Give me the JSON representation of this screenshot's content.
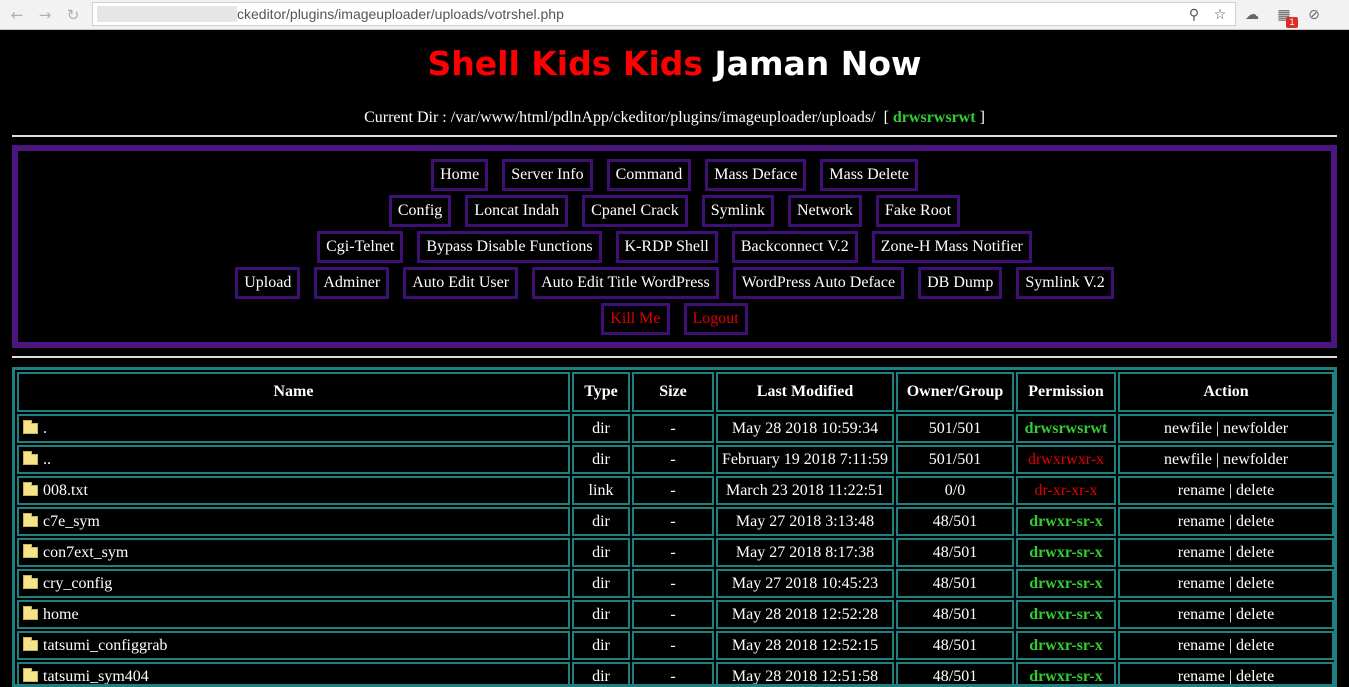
{
  "browser": {
    "url": "ckeditor/plugins/imageuploader/uploads/votrshel.php",
    "badge_count": "1"
  },
  "page": {
    "title_red": "Shell Kids Kids",
    "title_white": "Jaman Now",
    "current_dir_label": "Current Dir :",
    "current_dir": "/var/www/html/pdlnApp/ckeditor/plugins/imageuploader/uploads/",
    "current_perm": "drwsrwsrwt"
  },
  "menu": {
    "row1": [
      "Home",
      "Server Info",
      "Command",
      "Mass Deface",
      "Mass Delete"
    ],
    "row2": [
      "Config",
      "Loncat Indah",
      "Cpanel Crack",
      "Symlink",
      "Network",
      "Fake Root"
    ],
    "row3": [
      "Cgi-Telnet",
      "Bypass Disable Functions",
      "K-RDP Shell",
      "Backconnect V.2",
      "Zone-H Mass Notifier"
    ],
    "row4": [
      "Upload",
      "Adminer",
      "Auto Edit User",
      "Auto Edit Title WordPress",
      "WordPress Auto Deface",
      "DB Dump",
      "Symlink V.2"
    ],
    "row5": [
      "Kill Me",
      "Logout"
    ]
  },
  "table": {
    "headers": [
      "Name",
      "Type",
      "Size",
      "Last Modified",
      "Owner/Group",
      "Permission",
      "Action"
    ],
    "rows": [
      {
        "name": ".",
        "type": "dir",
        "size": "-",
        "modified": "May 28 2018 10:59:34",
        "owner": "501/501",
        "perm": "drwsrwsrwt",
        "perm_color": "green",
        "action1": "newfile",
        "action2": "newfolder"
      },
      {
        "name": "..",
        "type": "dir",
        "size": "-",
        "modified": "February 19 2018 7:11:59",
        "owner": "501/501",
        "perm": "drwxrwxr-x",
        "perm_color": "red",
        "action1": "newfile",
        "action2": "newfolder"
      },
      {
        "name": "008.txt",
        "type": "link",
        "size": "-",
        "modified": "March 23 2018 11:22:51",
        "owner": "0/0",
        "perm": "dr-xr-xr-x",
        "perm_color": "red",
        "action1": "rename",
        "action2": "delete"
      },
      {
        "name": "c7e_sym",
        "type": "dir",
        "size": "-",
        "modified": "May 27 2018 3:13:48",
        "owner": "48/501",
        "perm": "drwxr-sr-x",
        "perm_color": "green",
        "action1": "rename",
        "action2": "delete"
      },
      {
        "name": "con7ext_sym",
        "type": "dir",
        "size": "-",
        "modified": "May 27 2018 8:17:38",
        "owner": "48/501",
        "perm": "drwxr-sr-x",
        "perm_color": "green",
        "action1": "rename",
        "action2": "delete"
      },
      {
        "name": "cry_config",
        "type": "dir",
        "size": "-",
        "modified": "May 27 2018 10:45:23",
        "owner": "48/501",
        "perm": "drwxr-sr-x",
        "perm_color": "green",
        "action1": "rename",
        "action2": "delete"
      },
      {
        "name": "home",
        "type": "dir",
        "size": "-",
        "modified": "May 28 2018 12:52:28",
        "owner": "48/501",
        "perm": "drwxr-sr-x",
        "perm_color": "green",
        "action1": "rename",
        "action2": "delete"
      },
      {
        "name": "tatsumi_configgrab",
        "type": "dir",
        "size": "-",
        "modified": "May 28 2018 12:52:15",
        "owner": "48/501",
        "perm": "drwxr-sr-x",
        "perm_color": "green",
        "action1": "rename",
        "action2": "delete"
      },
      {
        "name": "tatsumi_sym404",
        "type": "dir",
        "size": "-",
        "modified": "May 28 2018 12:51:58",
        "owner": "48/501",
        "perm": "drwxr-sr-x",
        "perm_color": "green",
        "action1": "rename",
        "action2": "delete"
      }
    ]
  },
  "icons": {
    "back": "back-arrow-icon",
    "forward": "forward-arrow-icon",
    "reload": "reload-icon",
    "key": "key-icon",
    "star": "star-icon",
    "folder": "folder-icon"
  },
  "colors": {
    "accent_menu_border": "#4b1680",
    "table_border": "#1f8080",
    "perm_green": "#33cc33",
    "perm_red": "#e00000",
    "title_red": "#ff0000"
  }
}
